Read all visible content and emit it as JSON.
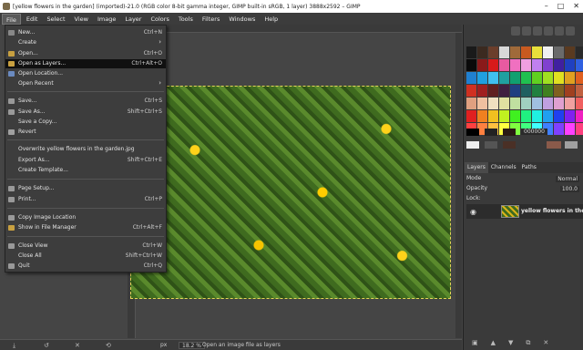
{
  "window": {
    "title": "[yellow flowers in the garden] (imported)-21.0 (RGB color 8-bit gamma integer, GIMP built-in sRGB, 1 layer) 3888x2592 – GIMP",
    "controls": [
      "–",
      "□",
      "✕"
    ]
  },
  "menubar": [
    "File",
    "Edit",
    "Select",
    "View",
    "Image",
    "Layer",
    "Colors",
    "Tools",
    "Filters",
    "Windows",
    "Help"
  ],
  "file_menu": [
    {
      "label": "New...",
      "shortcut": "Ctrl+N"
    },
    {
      "label": "Create",
      "shortcut": "",
      "submenu": true
    },
    {
      "label": "Open...",
      "shortcut": "Ctrl+O"
    },
    {
      "label": "Open as Layers...",
      "shortcut": "Ctrl+Alt+O",
      "highlighted": true
    },
    {
      "label": "Open Location...",
      "shortcut": ""
    },
    {
      "label": "Open Recent",
      "shortcut": "",
      "submenu": true
    },
    {
      "label": "Save...",
      "shortcut": "Ctrl+S"
    },
    {
      "label": "Save As...",
      "shortcut": "Shift+Ctrl+S"
    },
    {
      "label": "Save a Copy...",
      "shortcut": ""
    },
    {
      "label": "Revert",
      "shortcut": ""
    },
    {
      "label": "Overwrite yellow flowers in the garden.jpg",
      "shortcut": ""
    },
    {
      "label": "Export As...",
      "shortcut": "Shift+Ctrl+E"
    },
    {
      "label": "Create Template...",
      "shortcut": ""
    },
    {
      "label": "Page Setup...",
      "shortcut": ""
    },
    {
      "label": "Print...",
      "shortcut": "Ctrl+P"
    },
    {
      "label": "Copy Image Location",
      "shortcut": ""
    },
    {
      "label": "Show in File Manager",
      "shortcut": "Ctrl+Alt+F"
    },
    {
      "label": "Close View",
      "shortcut": "Ctrl+W"
    },
    {
      "label": "Close All",
      "shortcut": "Shift+Ctrl+W"
    },
    {
      "label": "Quit",
      "shortcut": "Ctrl+Q"
    }
  ],
  "statusbar": {
    "unit": "px",
    "zoom": "18.2 %",
    "message": "Open an image file as layers"
  },
  "colors": {
    "fg_hex": "000000",
    "palette": [
      "#1a1a1a",
      "#3b2a20",
      "#6b3e2b",
      "#d8d8d8",
      "#a06a3a",
      "#c85a20",
      "#e8e03a",
      "#f0f0f0",
      "#6a6a6a",
      "#5a3a20",
      "#2a2a2a",
      "#0a0a0a",
      "#8a1a1a",
      "#d81a1a",
      "#e85aa0",
      "#f070c0",
      "#f0a0e0",
      "#c080f0",
      "#8040d0",
      "#4020a0",
      "#2040c0",
      "#3060e0",
      "#2080d0",
      "#20a0e0",
      "#40c0f0",
      "#20a0a0",
      "#10a070",
      "#20c050",
      "#60d020",
      "#a0e020",
      "#e0e020",
      "#e0a020",
      "#e06020",
      "#d03020",
      "#a02020",
      "#602020",
      "#402040",
      "#204080",
      "#206060",
      "#208040",
      "#408020",
      "#806020",
      "#a04020",
      "#c06040",
      "#e0a080",
      "#f0c0a0",
      "#f0e0c0",
      "#e0e0a0",
      "#c0e0a0",
      "#a0d0c0",
      "#a0c0e0",
      "#c0a0e0",
      "#e0a0d0",
      "#f0a0a0",
      "#f06060",
      "#e02020",
      "#f08020",
      "#f0c020",
      "#c0f020",
      "#40f020",
      "#20f080",
      "#20f0e0",
      "#20a0f0",
      "#2040f0",
      "#8020f0",
      "#f020c0",
      "#ff4040",
      "#ff8040",
      "#ffc040",
      "#ffff40",
      "#80ff40",
      "#40ff80",
      "#40ffff",
      "#4080ff",
      "#8040ff",
      "#ff40ff",
      "#ff4080"
    ],
    "accent_bg": "#454545"
  },
  "layers_panel": {
    "tabs": [
      "Layers",
      "Channels",
      "Paths"
    ],
    "mode_label": "Mode",
    "mode_value": "Normal",
    "opacity_label": "Opacity",
    "opacity_value": "100.0",
    "lock_label": "Lock:",
    "layer_name": "yellow flowers in the g"
  }
}
